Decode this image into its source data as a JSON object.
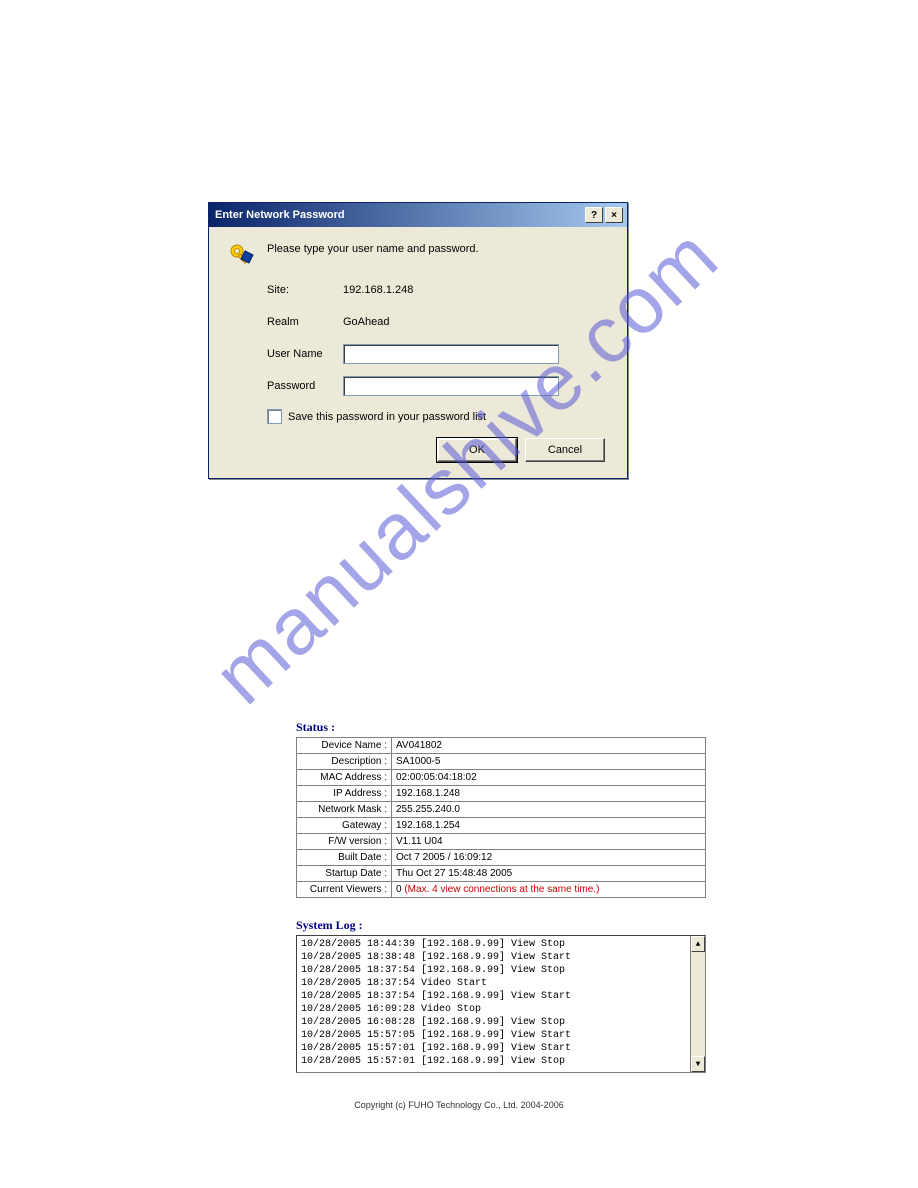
{
  "watermark": "manualshive.com",
  "dialog": {
    "title": "Enter Network Password",
    "help_btn": "?",
    "close_btn": "×",
    "prompt": "Please type your user name and password.",
    "site_label": "Site:",
    "site_value": "192.168.1.248",
    "realm_label": "Realm",
    "realm_value": "GoAhead",
    "username_label": "User Name",
    "username_value": "",
    "password_label": "Password",
    "password_value": "",
    "save_checkbox_label": "Save this password in your password list",
    "ok_label": "OK",
    "cancel_label": "Cancel"
  },
  "status": {
    "title": "Status :",
    "rows": [
      {
        "label": "Device Name :",
        "value": "AV041802"
      },
      {
        "label": "Description :",
        "value": "SA1000-5"
      },
      {
        "label": "MAC Address :",
        "value": "02:00:05:04:18:02"
      },
      {
        "label": "IP Address :",
        "value": "192.168.1.248"
      },
      {
        "label": "Network Mask :",
        "value": "255.255.240.0"
      },
      {
        "label": "Gateway :",
        "value": "192.168.1.254"
      },
      {
        "label": "F/W version :",
        "value": "V1.11 U04"
      },
      {
        "label": "Built Date :",
        "value": "Oct 7 2005 / 16:09:12"
      },
      {
        "label": "Startup Date :",
        "value": "Thu Oct 27 15:48:48 2005"
      }
    ],
    "current_viewers_label": "Current Viewers :",
    "current_viewers_value": "0",
    "current_viewers_note": "(Max. 4 view connections at the same time.)"
  },
  "log": {
    "title": "System Log :",
    "lines": [
      "10/28/2005 18:44:39 [192.168.9.99] View Stop",
      "10/28/2005 18:38:48 [192.168.9.99] View Start",
      "10/28/2005 18:37:54 [192.168.9.99] View Stop",
      "10/28/2005 18:37:54 Video Start",
      "10/28/2005 18:37:54 [192.168.9.99] View Start",
      "10/28/2005 16:09:28 Video Stop",
      "10/28/2005 16:08:28 [192.168.9.99] View Stop",
      "10/28/2005 15:57:05 [192.168.9.99] View Start",
      "10/28/2005 15:57:01 [192.168.9.99] View Start",
      "10/28/2005 15:57:01 [192.168.9.99] View Stop"
    ]
  },
  "footer": "Copyright (c) FUHO Technology Co., Ltd. 2004-2006"
}
